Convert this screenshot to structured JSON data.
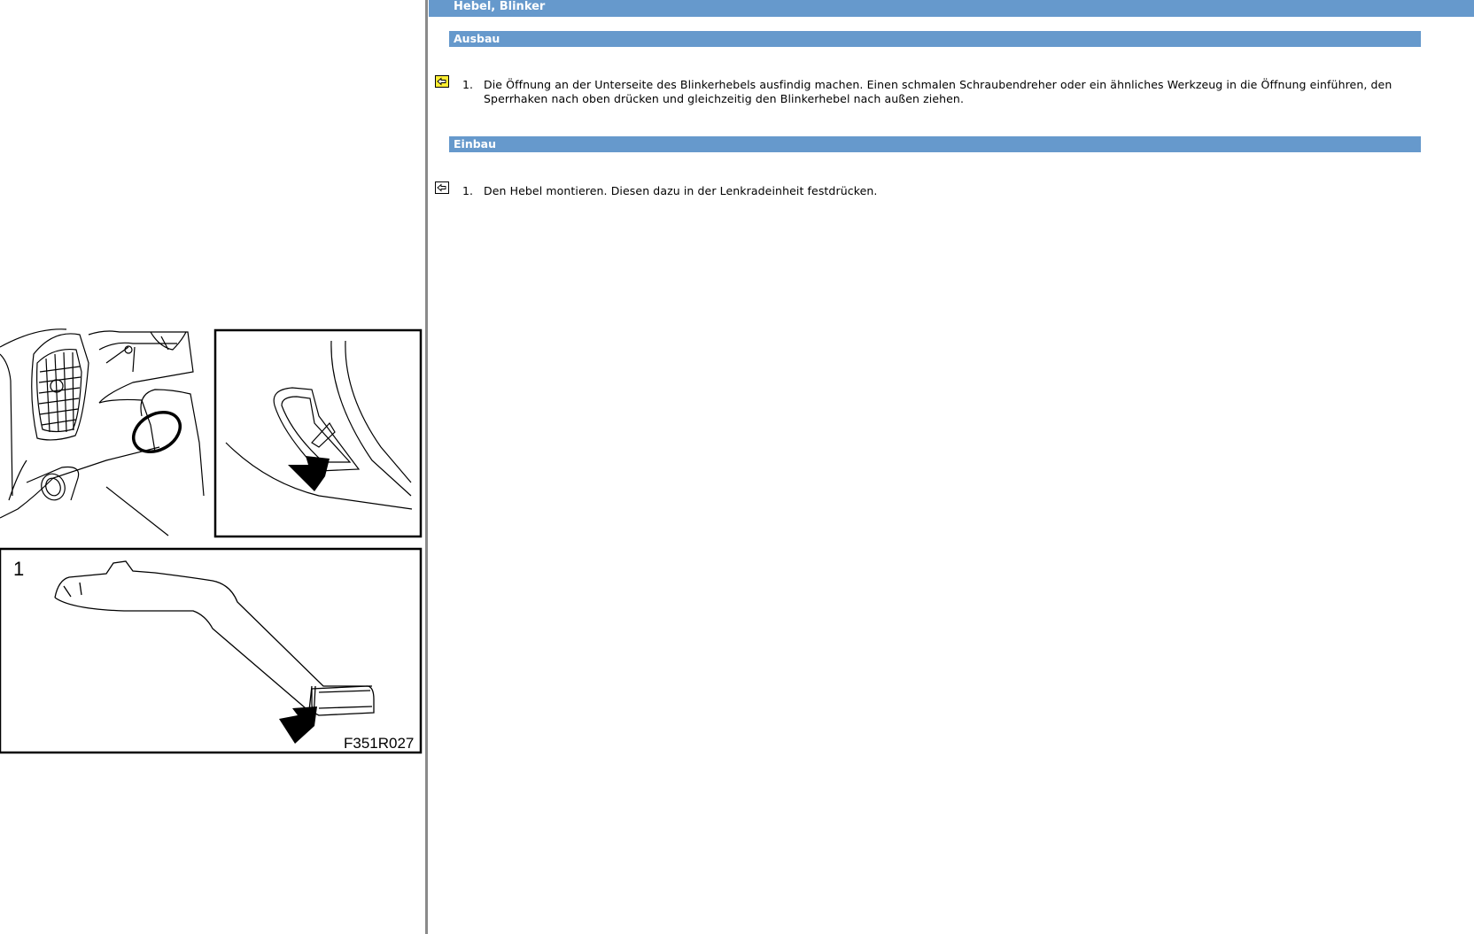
{
  "figure": {
    "panel_number": "1",
    "figure_code": "F351R027"
  },
  "document": {
    "title": "Hebel, Blinker",
    "sections": [
      {
        "heading": "Ausbau",
        "steps": [
          {
            "number": "1.",
            "text": "Die Öffnung an der Unterseite des Blinkerhebels ausfindig machen. Einen schmalen Schraubendreher oder ein ähnliches Werkzeug in die Öffnung einführen, den Sperrhaken nach oben drücken und gleichzeitig den Blinkerhebel nach außen ziehen.",
            "icon": "back-to-figure-icon-highlighted"
          }
        ]
      },
      {
        "heading": "Einbau",
        "steps": [
          {
            "number": "1.",
            "text": "Den Hebel montieren. Diesen dazu in der Lenkradeinheit festdrücken.",
            "icon": "back-to-figure-icon"
          }
        ]
      }
    ]
  },
  "colors": {
    "header_blue": "#6699cc",
    "icon_yellow": "#ffee33"
  }
}
